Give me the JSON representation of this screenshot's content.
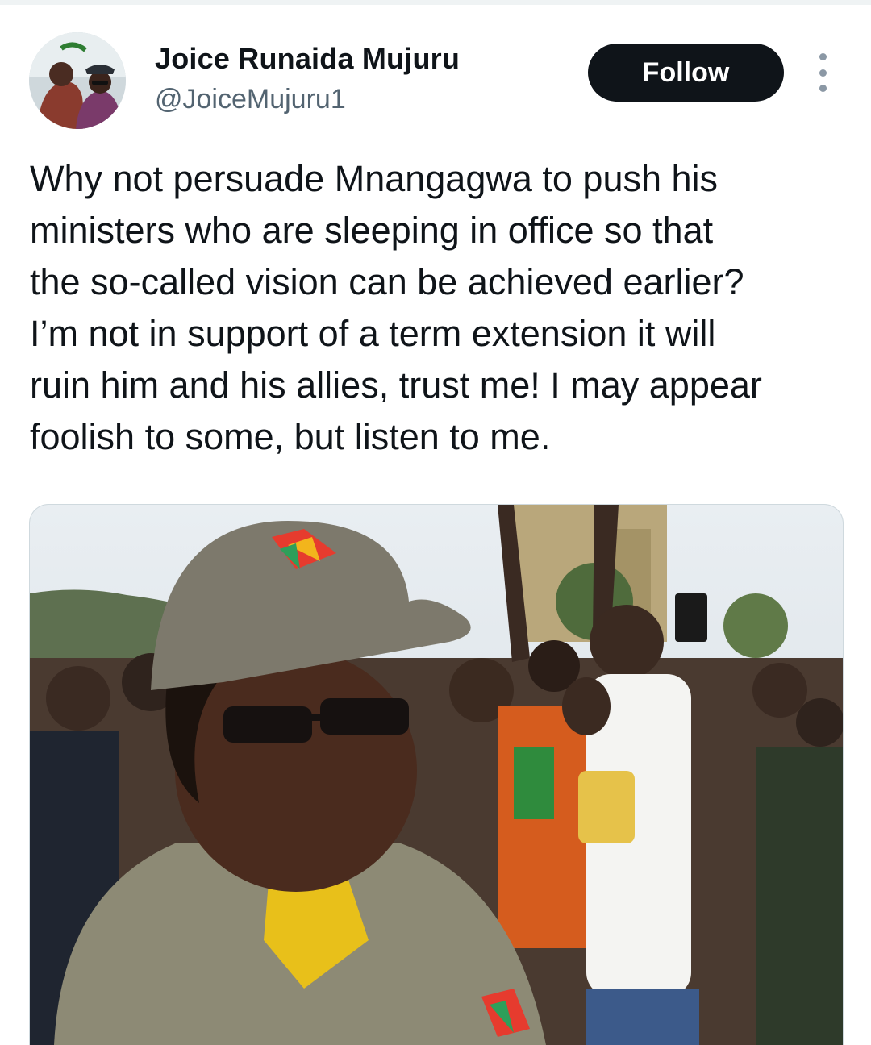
{
  "author": {
    "name": "Joice Runaida Mujuru",
    "handle": "@JoiceMujuru1"
  },
  "actions": {
    "follow_label": "Follow"
  },
  "tweet": {
    "text": "Why not persuade Mnangagwa to push his\nministers who are sleeping in office so that\nthe so-called vision can be achieved earlier?\nI’m not in support of a term extension it will\nruin him and his allies, trust me! I may appear\nfoolish to some, but listen to me."
  },
  "icons": {
    "more": "more-vertical-icon"
  },
  "colors": {
    "follow_bg": "#0f1419",
    "handle": "#536471",
    "text": "#0f1419"
  }
}
